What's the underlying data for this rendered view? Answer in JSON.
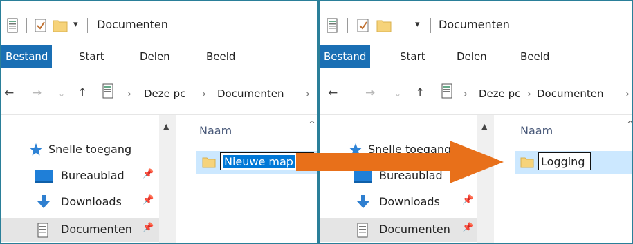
{
  "left": {
    "title": "Documenten",
    "ribbon_tabs": [
      "Bestand",
      "Start",
      "Delen",
      "Beeld"
    ],
    "breadcrumb": [
      "Deze pc",
      "Documenten"
    ],
    "column_header": "Naam",
    "nav_items": [
      "Snelle toegang",
      "Bureaublad",
      "Downloads",
      "Documenten"
    ],
    "rename_value": "Nieuwe map"
  },
  "right": {
    "title": "Documenten",
    "ribbon_tabs": [
      "Bestand",
      "Start",
      "Delen",
      "Beeld"
    ],
    "breadcrumb": [
      "Deze pc",
      "Documenten"
    ],
    "column_header": "Naam",
    "nav_items": [
      "Snelle toegang",
      "Bureaublad",
      "Downloads",
      "Documenten"
    ],
    "rename_value": "Logging"
  },
  "icons": {
    "properties": "properties-icon",
    "checkmark": "checkmark-icon",
    "folder": "folder-icon",
    "pin": "pin-icon",
    "star": "star-icon",
    "desktop": "desktop-icon",
    "downloads": "download-arrow-icon",
    "documents": "documents-icon"
  },
  "colors": {
    "accent": "#1a6fb4",
    "panel_border": "#2a7f99",
    "selection": "#cce8ff",
    "arrow": "#e8701a"
  }
}
